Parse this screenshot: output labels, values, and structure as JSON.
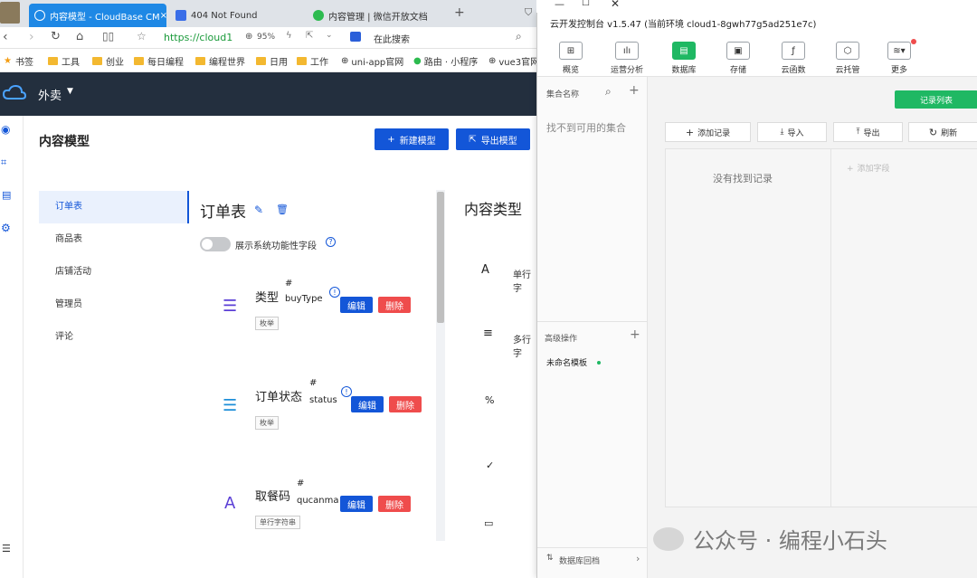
{
  "tabs": [
    {
      "label": "内容模型 - CloudBase CM",
      "active": true
    },
    {
      "label": "404 Not Found",
      "active": false
    },
    {
      "label": "内容管理 | 微信开放文档",
      "active": false
    }
  ],
  "tab_add": "+",
  "address": {
    "url": "https://cloud1",
    "zoom": "95%",
    "search_placeholder": "在此搜索"
  },
  "bookmarks": [
    "书签",
    "工具",
    "创业",
    "每日编程",
    "编程世界",
    "日用",
    "工作",
    "uni-app官网",
    "路由 · 小程序",
    "vue3官网"
  ],
  "app": {
    "env": "外卖"
  },
  "page": {
    "title": "内容模型",
    "new_model": "新建模型",
    "export_model": "导出模型"
  },
  "models": [
    "订单表",
    "商品表",
    "店铺活动",
    "管理员",
    "评论"
  ],
  "detail": {
    "title": "订单表",
    "toggle_label": "展示系统功能性字段",
    "edit_label": "编辑",
    "delete_label": "删除",
    "fields": [
      {
        "name": "类型",
        "hash": "#",
        "key": "buyType",
        "tag": "枚举"
      },
      {
        "name": "订单状态",
        "hash": "#",
        "key": "status",
        "tag": "枚举"
      },
      {
        "name": "取餐码",
        "hash": "#",
        "key": "qucanma",
        "tag": "单行字符串"
      }
    ]
  },
  "content_types": {
    "title": "内容类型",
    "items": [
      "单行字",
      "多行字",
      "",
      "",
      ""
    ]
  },
  "console": {
    "title": "云开发控制台 v1.5.47 (当前环境 cloud1-8gwh77g5ad251e7c)",
    "toolbar": [
      "概览",
      "运营分析",
      "数据库",
      "存储",
      "云函数",
      "云托管",
      "更多"
    ],
    "collection_header": "集合名称",
    "no_collection": "找不到可用的集合",
    "advanced": "高级操作",
    "template": "未命名模板",
    "db_backup": "数据库回档",
    "record_list": "记录列表",
    "actions": [
      "添加记录",
      "导入",
      "导出",
      "刷新"
    ],
    "no_records": "没有找到记录",
    "add_field": "添加字段"
  },
  "watermark": "公众号 · 编程小石头",
  "colors": {
    "accent": "#1356d8",
    "danger": "#ef4c4c",
    "green": "#1fb863",
    "header": "#232f3e"
  }
}
